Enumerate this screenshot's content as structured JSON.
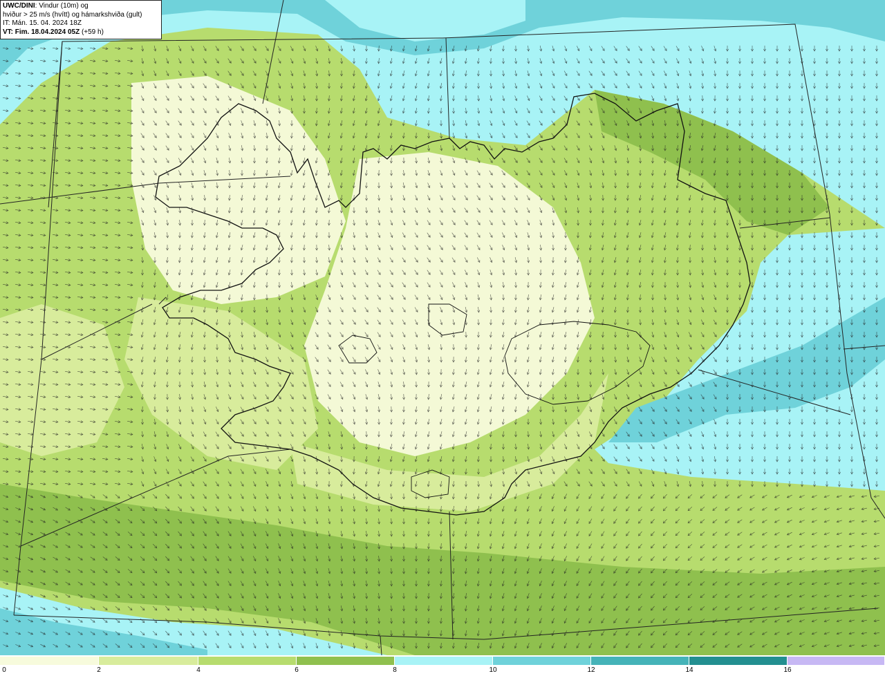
{
  "header": {
    "model": "UWC/DINI",
    "title_rest": ": Vindur (10m) og",
    "line2": "hviður > 25 m/s (hvítt) og hámarkshviða (gult)",
    "issue_time": "IT: Mán. 15. 04. 2024 18Z",
    "valid_time": "VT: Fim. 18.04.2024 05Z",
    "lead_time": "(+59 h)"
  },
  "legend": {
    "ticks": [
      "0",
      "2",
      "4",
      "6",
      "8",
      "10",
      "12",
      "14",
      "16"
    ],
    "colors": [
      "#f7fbdc",
      "#d8ec9c",
      "#b7dc6e",
      "#8fc04e",
      "#a8f3f6",
      "#6fd2da",
      "#45b3b8",
      "#238f90",
      "#c7b8f4"
    ]
  },
  "map": {
    "field_colors": {
      "calm": "#f4f9d6",
      "light": "#d8ec9c",
      "moderate": "#b7dc6e",
      "fresh": "#8fc04e",
      "strong": "#a8f3f6",
      "gale": "#6fd2da",
      "storm": "#45b3b8"
    },
    "arrow_color": "#222222",
    "coastline_color": "#111111"
  }
}
